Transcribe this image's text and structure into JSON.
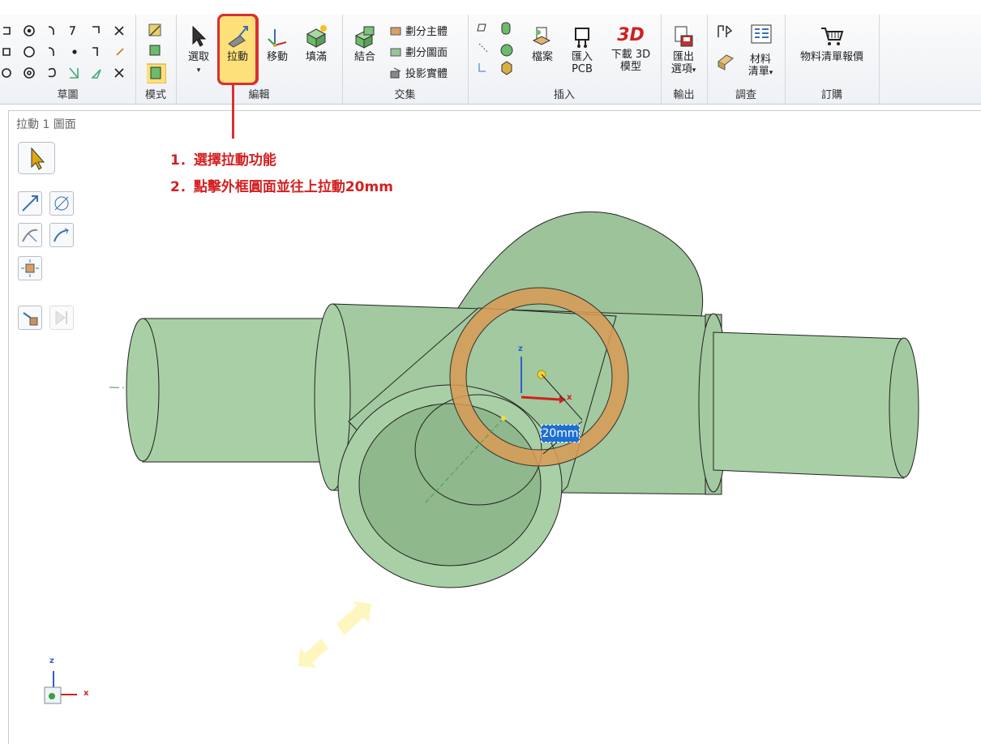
{
  "ribbon": {
    "groups": {
      "sketch": "草圖",
      "mode": "模式",
      "edit": "編輯",
      "intersect": "交集",
      "insert": "插入",
      "output": "輸出",
      "investigate": "調查",
      "order": "訂購"
    },
    "edit_tools": {
      "select": "選取",
      "pull": "拉動",
      "move": "移動",
      "fill": "填滿"
    },
    "intersect_tools": {
      "combine": "結合",
      "split_body": "劃分主體",
      "split_face": "劃分圖面",
      "project_solid": "投影實體"
    },
    "insert_tools": {
      "file": "檔案",
      "import_pcb_1": "匯入",
      "import_pcb_2": "PCB",
      "download_3d_1": "下載 3D",
      "download_3d_2": "模型",
      "label_3d": "3D"
    },
    "output_tools": {
      "export_1": "匯出",
      "export_2": "選項"
    },
    "investigate_tools": {
      "material_1": "材料",
      "material_2": "清單"
    },
    "order_tools": {
      "bom_quote": "物料清單報價"
    }
  },
  "viewport": {
    "title": "拉動 1 圖面",
    "dimension_value": "20mm",
    "axis_x": "x",
    "axis_z": "z"
  },
  "annotations": {
    "step1": "1．選擇拉動功能",
    "step2": "2．點擊外框圓面並往上拉動20mm"
  },
  "colors": {
    "highlight": "#fde07a",
    "callout_red": "#d32020",
    "model_green": "#a9cfa6",
    "selected_ring": "#d99a55",
    "dim_blue": "#1f6fd1"
  }
}
